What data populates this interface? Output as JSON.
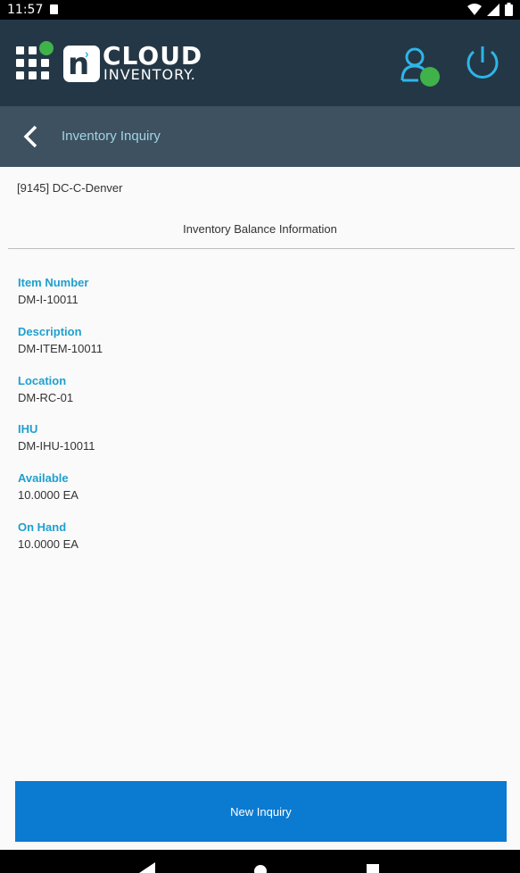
{
  "status_bar": {
    "time": "11:57"
  },
  "app": {
    "logo_cloud": "CLOUD",
    "logo_inventory": "INVENTORY."
  },
  "page": {
    "title": "Inventory Inquiry"
  },
  "org": "[9145] DC-C-Denver",
  "section_title": "Inventory Balance Information",
  "fields": [
    {
      "label": "Item Number",
      "value": "DM-I-10011"
    },
    {
      "label": "Description",
      "value": "DM-ITEM-10011"
    },
    {
      "label": "Location",
      "value": "DM-RC-01"
    },
    {
      "label": "IHU",
      "value": "DM-IHU-10011"
    },
    {
      "label": "Available",
      "value": "10.0000 EA"
    },
    {
      "label": "On Hand",
      "value": "10.0000 EA"
    }
  ],
  "button": {
    "new_inquiry": "New Inquiry"
  },
  "colors": {
    "header": "#243746",
    "subheader": "#3e5160",
    "accent": "#1f9fcf",
    "button": "#0b7ad1",
    "online": "#3fb24a"
  }
}
